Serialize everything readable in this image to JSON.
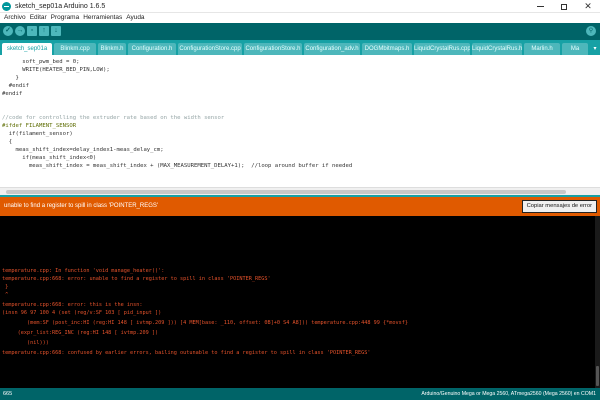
{
  "window": {
    "title": "sketch_sep01a Arduino 1.6.5",
    "minimize_label": "minimize",
    "maximize_label": "maximize",
    "close_label": "✕"
  },
  "menu": [
    "Archivo",
    "Editar",
    "Programa",
    "Herramientas",
    "Ayuda"
  ],
  "toolbar": {
    "verify_glyph": "✓",
    "upload_glyph": "→",
    "new_glyph": "▫",
    "open_glyph": "↑",
    "save_glyph": "↓",
    "serial_glyph": "⚲",
    "colors": {
      "toolbar_bg": "#006468",
      "tab_bg": "#17a1a5",
      "button": "#4db7bb"
    }
  },
  "tabs": [
    "sketch_sep01a",
    "Blinkm.cpp",
    "Blinkm.h",
    "Configuration.h",
    "ConfigurationStore.cpp",
    "ConfigurationStore.h",
    "Configuration_adv.h",
    "DOGMbitmaps.h",
    "LiquidCrystalRus.cpp",
    "LiquidCrystalRus.h",
    "Marlin.h",
    "Ma"
  ],
  "tab_overflow": "▾",
  "code": [
    "      soft_pwm_bed = 0;",
    "      WRITE(HEATER_BED_PIN,LOW);",
    "    }",
    "  #endif",
    "#endif",
    "",
    "//code for controlling the extruder rate based on the width sensor",
    "#ifdef FILAMENT_SENSOR",
    "  if(filament_sensor)",
    "  {",
    "    meas_shift_index=delay_index1-meas_delay_cm;",
    "      if(meas_shift_index<0)",
    "        meas_shift_index = meas_shift_index + (MAX_MEASUREMENT_DELAY+1);  //loop around buffer if needed"
  ],
  "notification": {
    "message": "unable to find a register to spill in class 'POINTER_REGS'",
    "copy_button": "Copiar mensajes de error",
    "color": "#e05a00"
  },
  "console": [
    "temperature.cpp: In function 'void manage_heater()':",
    "temperature.cpp:668: error: unable to find a register to spill in class 'POINTER_REGS'",
    " }",
    " ^",
    "temperature.cpp:668: error: this is the insn:",
    "(insn 96 97 100 4 (set (reg/v:SF 103 [ pid_input ])",
    "        (mem:SF (post_inc:HI (reg:HI 148 [ ivtmp.209 ])) [4 MEM[base: _110, offset: 0B]+0 S4 A8])) temperature.cpp:448 99 {*movsf}",
    "     (expr_list:REG_INC (reg:HI 148 [ ivtmp.209 ])",
    "        (nil)))",
    "temperature.cpp:668: confused by earlier errors, bailing outunable to find a register to spill in class 'POINTER_REGS'"
  ],
  "status": {
    "line_number": "665",
    "board": "Arduino/Genuino Mega or Mega 2560, ATmega2560 (Mega 2560) en COM1"
  }
}
